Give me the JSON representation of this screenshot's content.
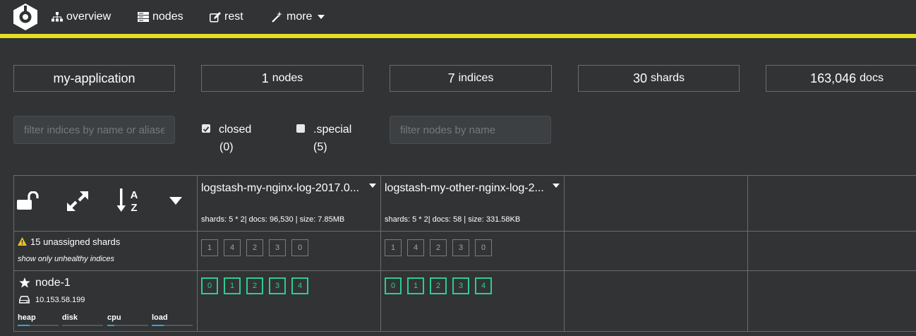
{
  "nav": {
    "items": [
      {
        "label": "overview",
        "icon": "sitemap-icon"
      },
      {
        "label": "nodes",
        "icon": "server-icon"
      },
      {
        "label": "rest",
        "icon": "edit-icon"
      },
      {
        "label": "more",
        "icon": "magic-icon"
      }
    ]
  },
  "stats": {
    "cluster_name": "my-application",
    "nodes": {
      "value": "1",
      "unit": "nodes"
    },
    "indices": {
      "value": "7",
      "unit": "indices"
    },
    "shards": {
      "value": "30",
      "unit": "shards"
    },
    "docs": {
      "value": "163,046",
      "unit": "docs"
    }
  },
  "filters": {
    "indices_placeholder": "filter indices by name or aliases",
    "closed_label": "closed",
    "closed_count": "(0)",
    "special_label": ".special",
    "special_count": "(5)",
    "nodes_placeholder": "filter nodes by name"
  },
  "indices": [
    {
      "name": "logstash-my-nginx-log-2017.0...",
      "meta": "shards: 5 * 2| docs: 96,530 | size: 7.85MB",
      "unassigned": [
        "1",
        "4",
        "2",
        "3",
        "0"
      ],
      "node_shards": [
        "0",
        "1",
        "2",
        "3",
        "4"
      ]
    },
    {
      "name": "logstash-my-other-nginx-log-2...",
      "meta": "shards: 5 * 2| docs: 58 | size: 331.58KB",
      "unassigned": [
        "1",
        "4",
        "2",
        "3",
        "0"
      ],
      "node_shards": [
        "0",
        "1",
        "2",
        "3",
        "4"
      ]
    }
  ],
  "unassigned": {
    "label": "15 unassigned shards",
    "toggle": "show only unhealthy indices"
  },
  "node": {
    "name": "node-1",
    "ip": "10.153.58.199",
    "metrics": [
      {
        "label": "heap",
        "level": 0.3
      },
      {
        "label": "disk",
        "level": 0.0
      },
      {
        "label": "cpu",
        "level": 0.18
      },
      {
        "label": "load",
        "level": 0.3
      }
    ]
  },
  "colors": {
    "accent": "#e6df24",
    "started_shard": "#2ecc8f",
    "metric_bar": "#2aa7e0",
    "warning": "#f0c419"
  }
}
